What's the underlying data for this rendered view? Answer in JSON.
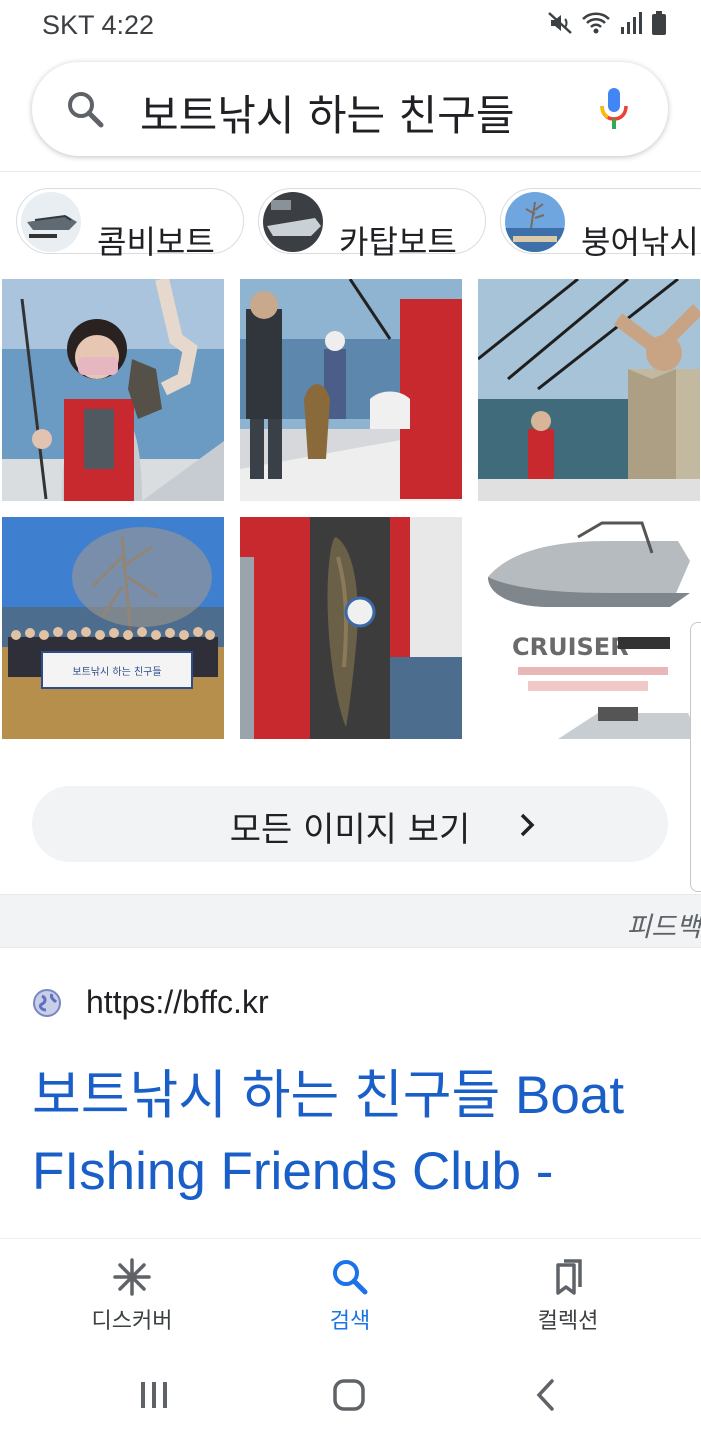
{
  "status_bar": {
    "carrier_time": "SKT 4:22",
    "icons": [
      "mute-icon",
      "wifi-icon",
      "signal-icon",
      "battery-icon"
    ]
  },
  "search": {
    "query": "보트낚시 하는 친구들",
    "icons": [
      "search-icon",
      "mic-icon"
    ]
  },
  "chips": [
    {
      "label": "콤비보트"
    },
    {
      "label": "카탑보트"
    },
    {
      "label": "붕어낚시"
    }
  ],
  "images": {
    "count": 6,
    "cruiser_text": "CRUISER",
    "banner_text": "보트낚시 하는 친구들"
  },
  "see_all": {
    "label": "모든 이미지 보기"
  },
  "feedback": {
    "label": "피드백"
  },
  "result": {
    "url": "https://bffc.kr",
    "title": "보트낚시 하는 친구들 Boat FIshing Friends Club -"
  },
  "bottom_nav": [
    {
      "label": "디스커버",
      "icon": "discover-icon",
      "active": false
    },
    {
      "label": "검색",
      "icon": "search-icon",
      "active": true
    },
    {
      "label": "컬렉션",
      "icon": "collections-icon",
      "active": false
    }
  ],
  "colors": {
    "accent": "#1a73e8",
    "link": "#1a5fc8",
    "chip_border": "#dadce0"
  }
}
